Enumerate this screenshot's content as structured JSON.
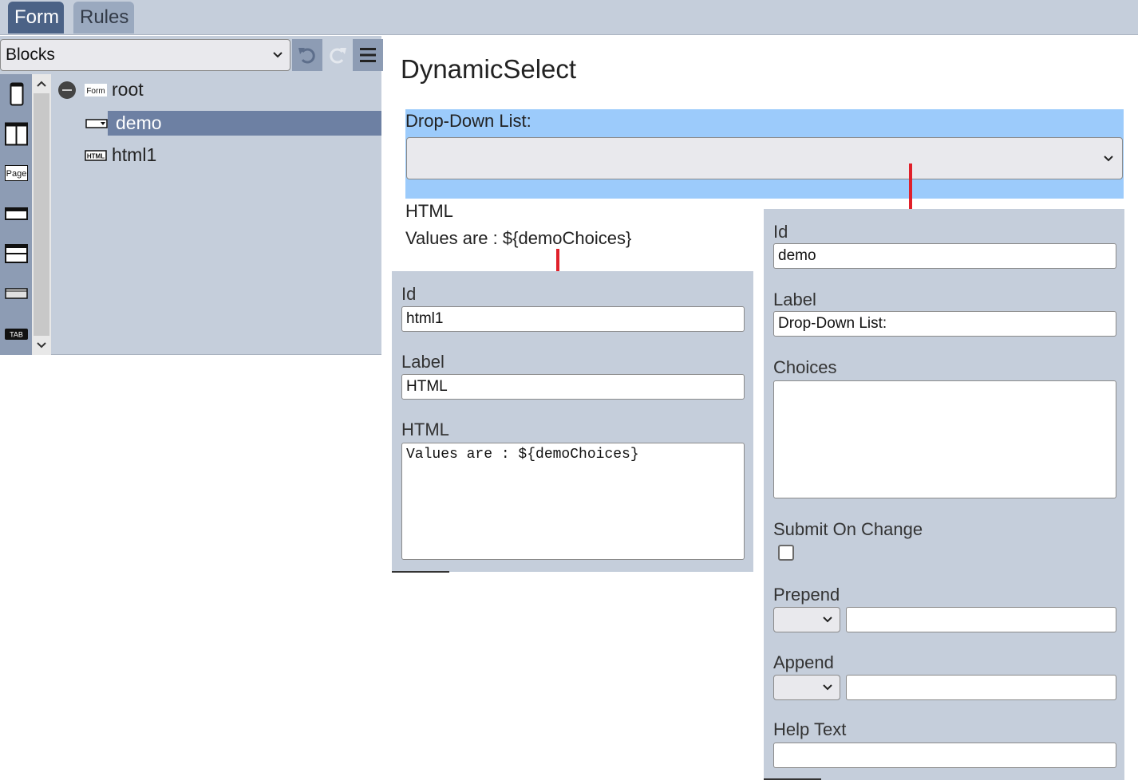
{
  "tabs": {
    "form": "Form",
    "rules": "Rules"
  },
  "toolbar": {
    "blocks_select": "Blocks",
    "undo_icon": "undo-icon",
    "redo_icon": "redo-icon",
    "menu_icon": "hamburger-menu-icon"
  },
  "palette": [
    {
      "icon": "single-column-icon"
    },
    {
      "icon": "two-column-icon"
    },
    {
      "icon": "page-icon",
      "text": "Page"
    },
    {
      "icon": "section-icon"
    },
    {
      "icon": "header-section-icon"
    },
    {
      "icon": "input-block-icon"
    },
    {
      "icon": "tab-icon",
      "text": "TAB"
    }
  ],
  "tree": {
    "items": [
      {
        "label": "root",
        "badge": "Form",
        "icon": "form-icon"
      },
      {
        "label": "demo",
        "icon": "dropdown-icon",
        "selected": true
      },
      {
        "label": "html1",
        "badge": "HTML",
        "icon": "html-icon"
      }
    ]
  },
  "canvas": {
    "title": "DynamicSelect",
    "select_label": "Drop-Down List:",
    "select_value": "",
    "html_label": "HTML",
    "html_value": "Values are : ${demoChoices}"
  },
  "html_props": {
    "id_label": "Id",
    "id_value": "html1",
    "label_label": "Label",
    "label_value": "HTML",
    "html_label": "HTML",
    "html_value": "Values are : ${demoChoices}"
  },
  "select_props": {
    "id_label": "Id",
    "id_value": "demo",
    "label_label": "Label",
    "label_value": "Drop-Down List:",
    "choices_label": "Choices",
    "choices_value": "",
    "submit_label": "Submit On Change",
    "submit_checked": false,
    "prepend_label": "Prepend",
    "prepend_value": "",
    "append_label": "Append",
    "append_value": "",
    "help_label": "Help Text",
    "help_value": ""
  },
  "colors": {
    "topbar": "#c5cedb",
    "active_tab": "#4b6286",
    "selected_row": "#6d80a3",
    "selected_block": "#9ccbfb",
    "connector": "#e0202a"
  }
}
